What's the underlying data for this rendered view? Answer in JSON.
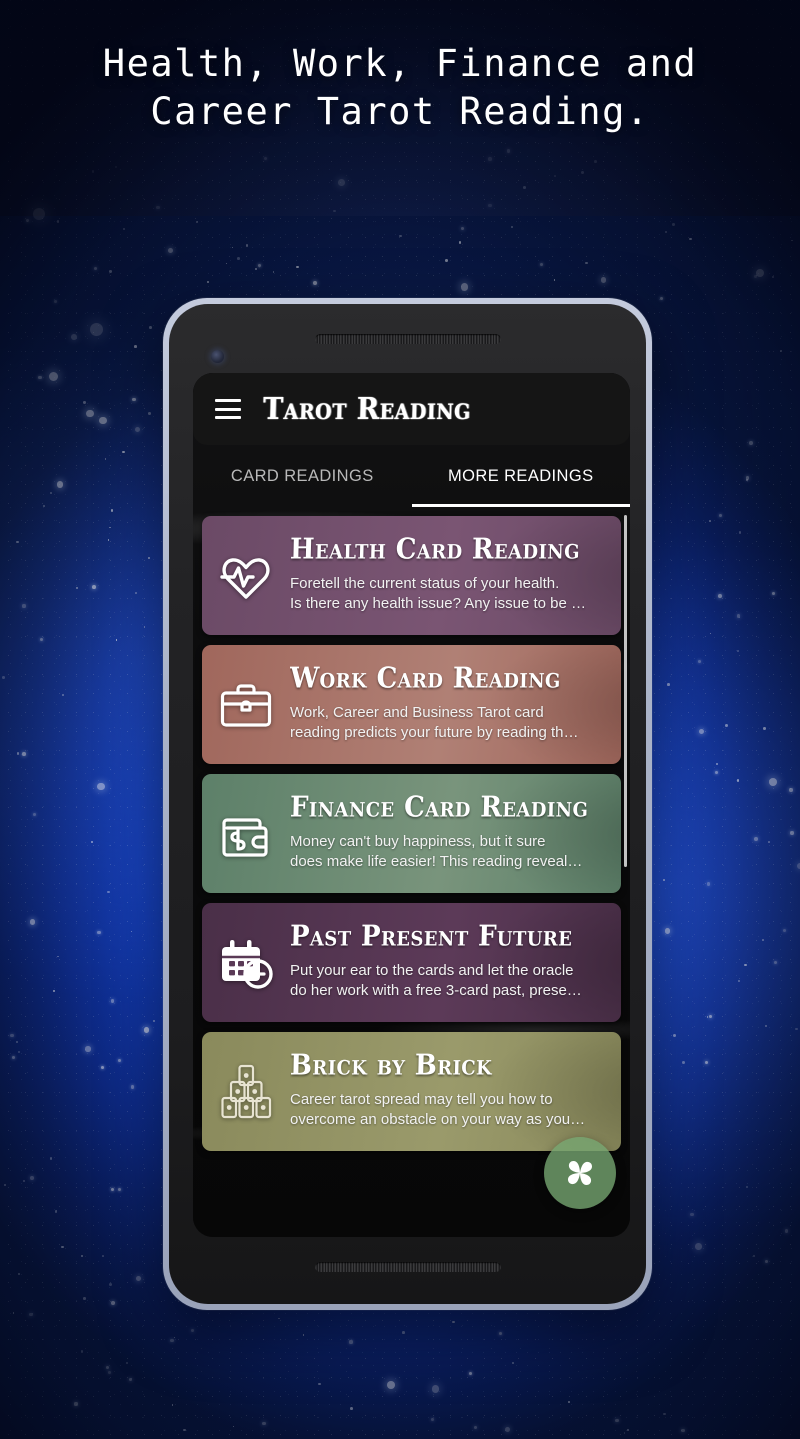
{
  "headline": {
    "line1": "Health, Work, Finance and",
    "line2": "Career Tarot Reading."
  },
  "phone": {
    "device_color": "#aab3c8",
    "screen_bg": "#0a0a0b"
  },
  "app": {
    "appbar": {
      "menu_icon": "hamburger-icon",
      "title": "Tarot Reading"
    },
    "tabs": [
      {
        "label": "CARD READINGS",
        "active": false
      },
      {
        "label": "MORE READINGS",
        "active": true
      }
    ],
    "active_tab_indicator_color": "#ffffff",
    "readings": [
      {
        "title": "Health Card Reading",
        "desc_line1": "Foretell the current status of your health.",
        "desc_line2": "Is there any health issue? Any issue to be …",
        "icon": "heart-pulse-icon",
        "color": "#6b4a66",
        "color_end": "#7a5573"
      },
      {
        "title": "Work Card Reading",
        "desc_line1": "Work, Career and Business Tarot card",
        "desc_line2": "reading predicts your future by reading th…",
        "icon": "briefcase-icon",
        "color": "#a0675c",
        "color_end": "#b08075"
      },
      {
        "title": "Finance Card Reading",
        "desc_line1": "Money can't buy happiness, but it sure",
        "desc_line2": "does make life easier! This reading reveal…",
        "icon": "wallet-dollar-icon",
        "color": "#5d8069",
        "color_end": "#79947c"
      },
      {
        "title": "Past Present Future",
        "desc_line1": "Put your ear to the cards and let the oracle",
        "desc_line2": "do her work with a free 3-card past, prese…",
        "icon": "calendar-clock-icon",
        "color": "#4a2f48",
        "color_end": "#5c3a58"
      },
      {
        "title": "Brick by Brick",
        "desc_line1": "Career tarot spread may tell you how to",
        "desc_line2": "overcome an obstacle on your way as you…",
        "icon": "card-pyramid-icon",
        "color": "#8a8a5c",
        "color_end": "#9a9a6b"
      }
    ],
    "fab": {
      "icon": "pinwheel-icon",
      "color": "#76a570"
    }
  }
}
